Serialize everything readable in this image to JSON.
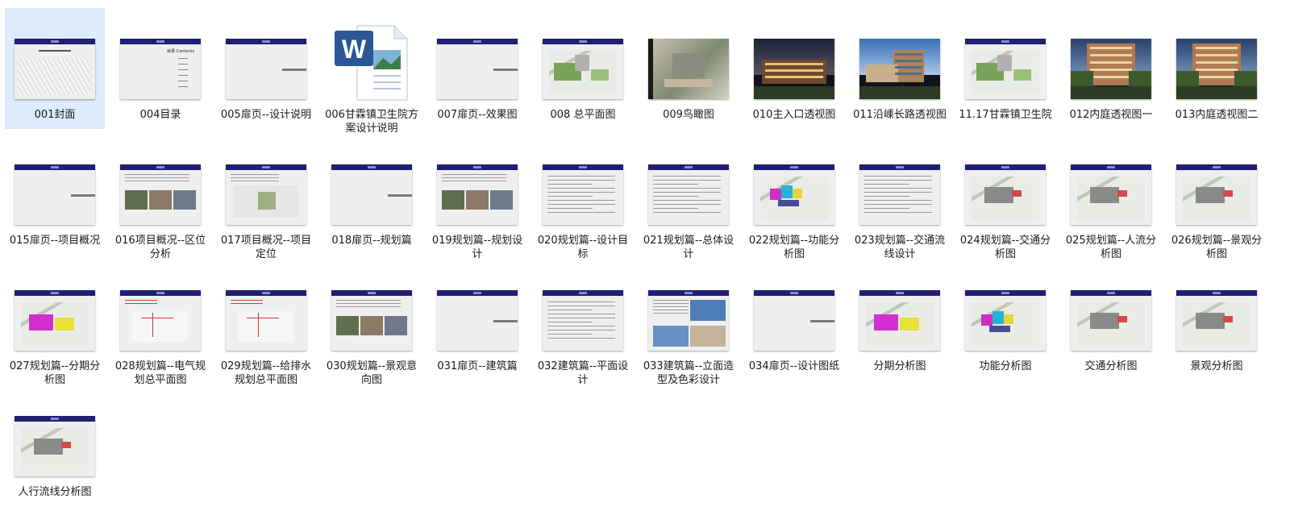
{
  "files": [
    {
      "name": "001封面",
      "type": "cover",
      "selected": true
    },
    {
      "name": "004目录",
      "type": "toc"
    },
    {
      "name": "005扉页--设计说明",
      "type": "divider"
    },
    {
      "name": "006甘霖镇卫生院方案设计说明",
      "type": "word"
    },
    {
      "name": "007扉页--效果图",
      "type": "divider"
    },
    {
      "name": "008 总平面图",
      "type": "siteplan"
    },
    {
      "name": "009鸟瞰图",
      "type": "aerial"
    },
    {
      "name": "010主入口透视图",
      "type": "photo-dusk"
    },
    {
      "name": "011沿嵊长路透视图",
      "type": "photo-day"
    },
    {
      "name": "11.17甘霖镇卫生院",
      "type": "siteplan"
    },
    {
      "name": "012内庭透视图一",
      "type": "photo-court"
    },
    {
      "name": "013内庭透视图二",
      "type": "photo-court"
    },
    {
      "name": "015扉页--项目概况",
      "type": "divider"
    },
    {
      "name": "016项目概况--区位分析",
      "type": "text-photos"
    },
    {
      "name": "017项目概况--项目定位",
      "type": "text-map"
    },
    {
      "name": "018扉页--规划篇",
      "type": "divider"
    },
    {
      "name": "019规划篇--规划设计",
      "type": "text-photos"
    },
    {
      "name": "020规划篇--设计目标",
      "type": "text-doc"
    },
    {
      "name": "021规划篇--总体设计",
      "type": "text-doc"
    },
    {
      "name": "022规划篇--功能分析图",
      "type": "color-map"
    },
    {
      "name": "023规划篇--交通流线设计",
      "type": "text-doc"
    },
    {
      "name": "024规划篇--交通分析图",
      "type": "gray-map"
    },
    {
      "name": "025规划篇--人流分析图",
      "type": "gray-map"
    },
    {
      "name": "026规划篇--景观分析图",
      "type": "gray-map"
    },
    {
      "name": "027规划篇--分期分析图",
      "type": "phase-map"
    },
    {
      "name": "028规划篇--电气规划总平面图",
      "type": "line-map"
    },
    {
      "name": "029规划篇--给排水规划总平面图",
      "type": "line-map"
    },
    {
      "name": "030规划篇--景观意向图",
      "type": "text-photos"
    },
    {
      "name": "031扉页--建筑篇",
      "type": "divider"
    },
    {
      "name": "032建筑篇--平面设计",
      "type": "text-doc"
    },
    {
      "name": "033建筑篇--立面造型及色彩设计",
      "type": "elevation"
    },
    {
      "name": "034扉页--设计图纸",
      "type": "divider"
    },
    {
      "name": "分期分析图",
      "type": "phase-map"
    },
    {
      "name": "功能分析图",
      "type": "color-map"
    },
    {
      "name": "交通分析图",
      "type": "gray-map"
    },
    {
      "name": "景观分析图",
      "type": "gray-map"
    },
    {
      "name": "人行流线分析图",
      "type": "gray-map"
    }
  ],
  "toc_thumb_text": "目录 Contents",
  "colors": {
    "header": "#1f1f73",
    "selection": "#dcecfc",
    "word_blue": "#2b5797"
  }
}
